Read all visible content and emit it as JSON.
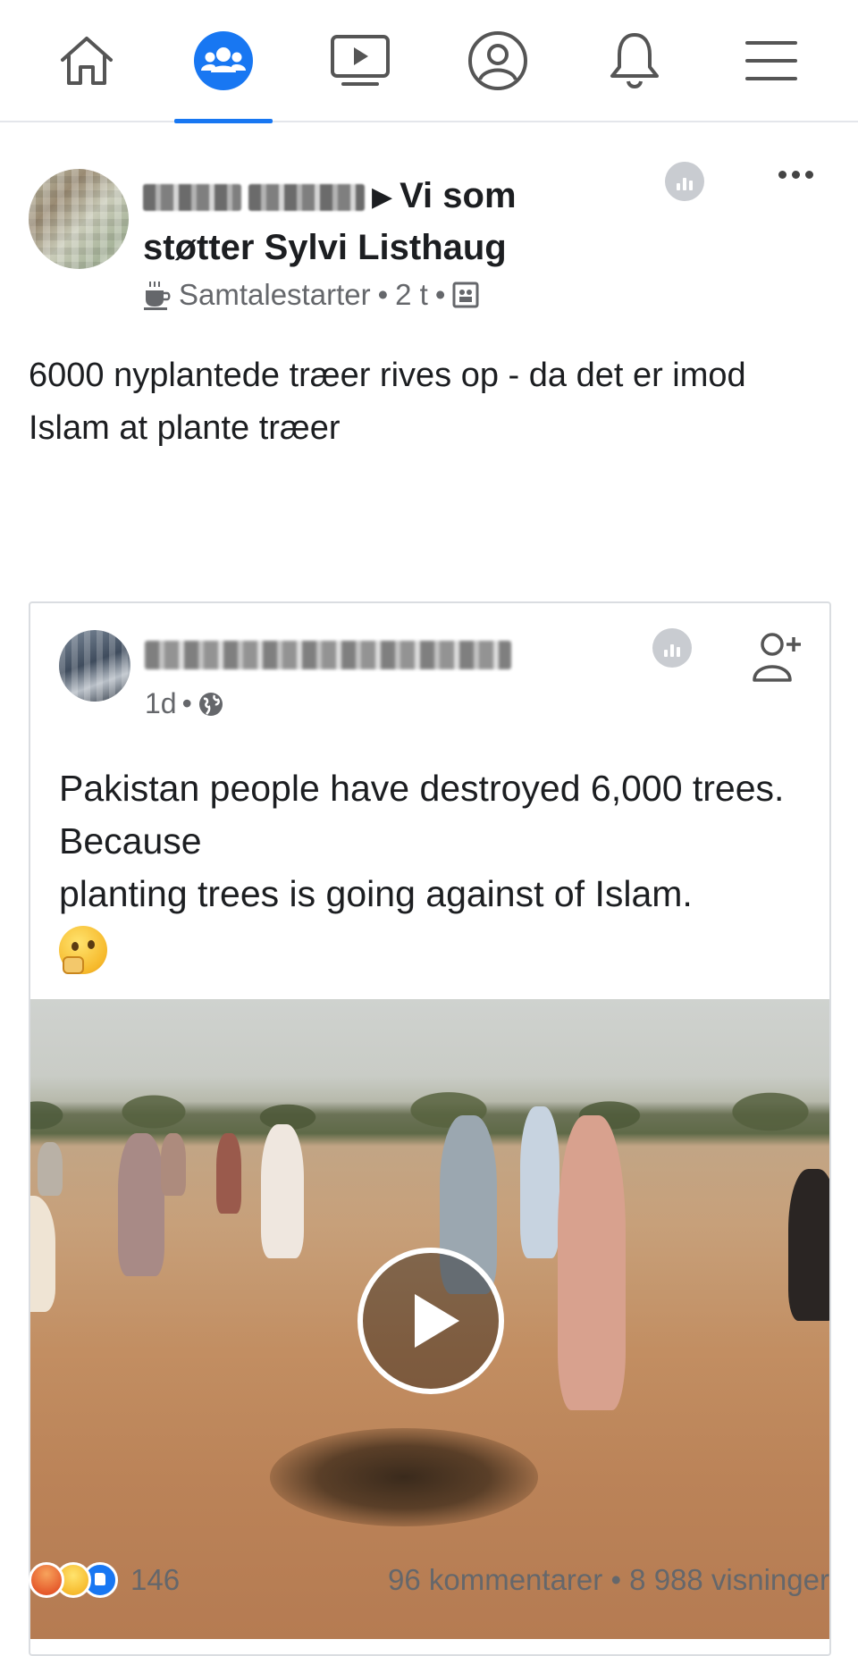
{
  "nav": {
    "items": [
      {
        "name": "home",
        "icon": "home-icon",
        "active": false
      },
      {
        "name": "groups",
        "icon": "groups-icon",
        "active": true
      },
      {
        "name": "watch",
        "icon": "video-icon",
        "active": false
      },
      {
        "name": "profile",
        "icon": "profile-icon",
        "active": false
      },
      {
        "name": "notifications",
        "icon": "bell-icon",
        "active": false
      },
      {
        "name": "menu",
        "icon": "hamburger-menu-icon",
        "active": false
      }
    ],
    "accent": "#1877f2"
  },
  "post": {
    "group_name": "Vi som støtter Sylvi Listhaug",
    "badge": "Samtalestarter",
    "time": "2 t",
    "text": "6000 nyplantede træer rives op - da det er imod Islam at plante træer"
  },
  "shared_post": {
    "time": "1d",
    "text_line1": "Pakistan people have destroyed 6,000 trees. Because",
    "text_line2": "planting trees is going against of Islam."
  },
  "footer": {
    "reactions_count": "146",
    "comments": "96 kommentarer",
    "separator": "•",
    "views": "8 988 visninger"
  },
  "colors": {
    "text": "#1c1e21",
    "secondary": "#65676b",
    "divider": "#dadde1"
  }
}
